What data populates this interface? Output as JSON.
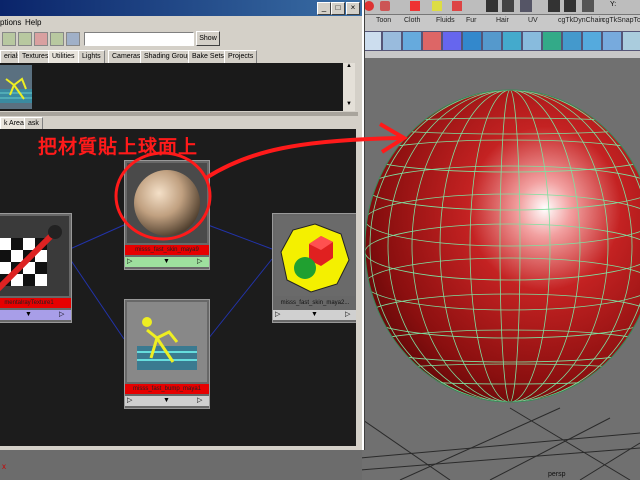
{
  "window": {
    "min": "_",
    "max": "□",
    "close": "×"
  },
  "menu": {
    "options": "ptions",
    "help": "Help"
  },
  "toolbar": {
    "show_label": "Show"
  },
  "top_tabs": [
    "erials",
    "Textures",
    "Utilities",
    "Lights",
    "Cameras",
    "Shading Groups",
    "Bake Sets",
    "Projects"
  ],
  "work_tabs": [
    "k Area",
    "ask"
  ],
  "annotation": "把材質貼上球面上",
  "nodes": {
    "skin_top": "misss_fast_skin_maya9",
    "texture": "mentalrayTexture1",
    "skin_right": "misss_fast_skin_maya2...",
    "bump": "misss_fast_bump_maya1"
  },
  "node_controls": {
    "left": "▷",
    "mid": "▼",
    "right": "▷"
  },
  "maya": {
    "top_right_letter": "Y:",
    "shelf_tabs": [
      "Toon",
      "Cloth",
      "Fluids",
      "Fur",
      "Hair",
      "UV",
      "cgTkDynChain",
      "cgTkSnapTo"
    ],
    "persp_label": "persp",
    "axis_x": "x"
  },
  "colors": {
    "sphere": "#a01818",
    "wire": "#7fe0a0",
    "annotation": "#ff1a1a",
    "title_bar": "#0a246a"
  }
}
